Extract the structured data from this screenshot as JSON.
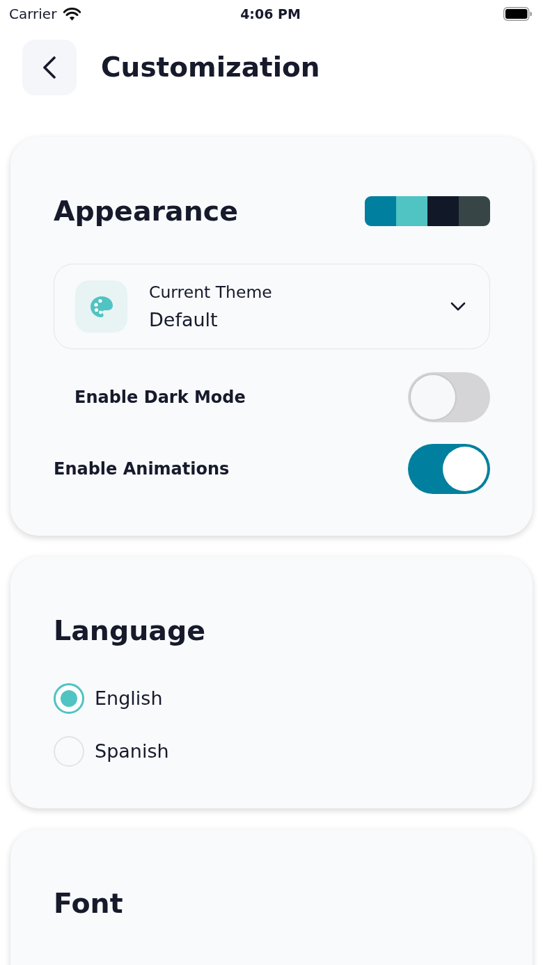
{
  "status_bar": {
    "carrier": "Carrier",
    "time": "4:06 PM"
  },
  "header": {
    "title": "Customization"
  },
  "sections": [
    {
      "kind": "appearance",
      "title": "Appearance",
      "palette": [
        {
          "color": "#00809e"
        },
        {
          "color": "#50c3c3"
        },
        {
          "color": "#111827"
        },
        {
          "color": "#374547"
        }
      ],
      "theme_select": {
        "label": "Current Theme",
        "value": "Default"
      },
      "toggles": [
        {
          "label": "Enable Dark Mode",
          "on": false
        },
        {
          "label": "Enable Animations",
          "on": true
        }
      ]
    },
    {
      "kind": "language",
      "title": "Language",
      "options": [
        {
          "label": "English",
          "selected": true
        },
        {
          "label": "Spanish",
          "selected": false
        }
      ]
    },
    {
      "kind": "font",
      "title": "Font"
    }
  ]
}
